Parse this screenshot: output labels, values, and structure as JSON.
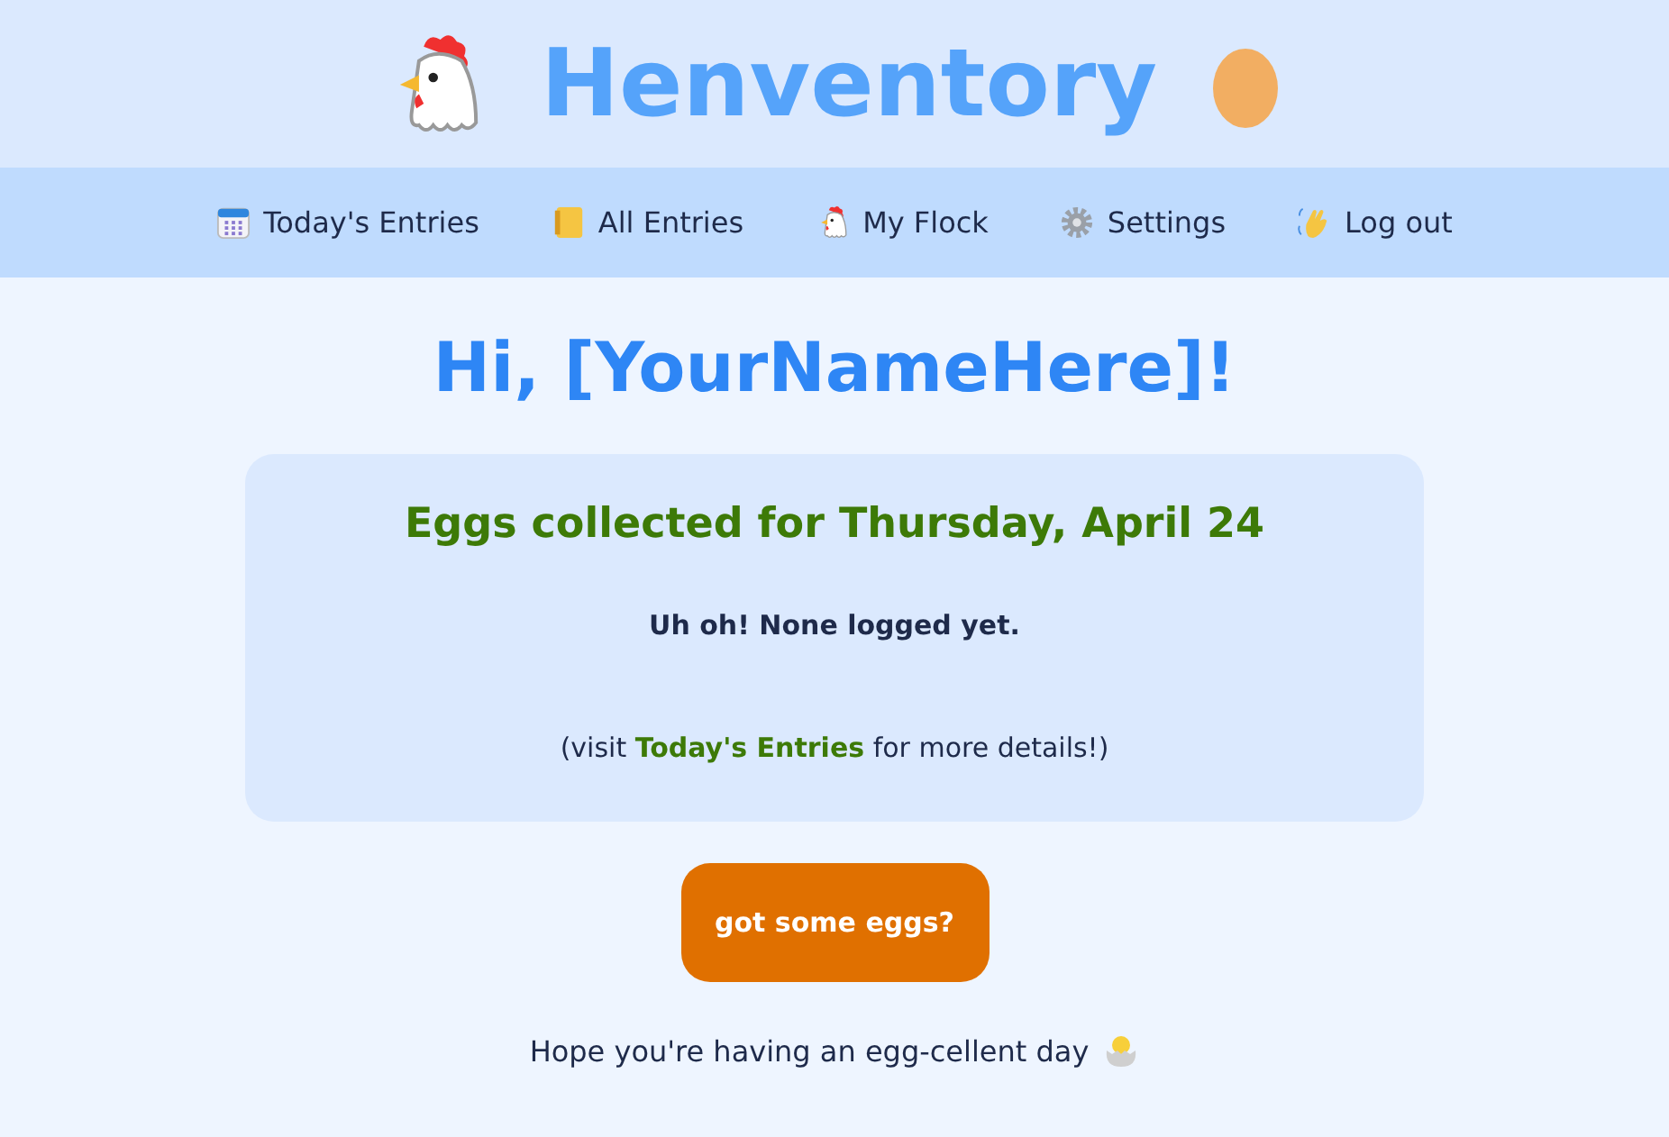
{
  "header": {
    "title": "Henventory"
  },
  "nav": [
    {
      "label": "Today's Entries",
      "kind": "calendar"
    },
    {
      "label": "All Entries",
      "kind": "notebook"
    },
    {
      "label": "My Flock",
      "kind": "chicken"
    },
    {
      "label": "Settings",
      "kind": "gear"
    },
    {
      "label": "Log out",
      "kind": "wave"
    }
  ],
  "greeting": "Hi, [YourNameHere]!",
  "card": {
    "title": "Eggs collected for Thursday, April 24",
    "status": "Uh oh! None logged yet.",
    "note_before": "(visit",
    "note_link": "Today's Entries",
    "note_after": "for more details!)"
  },
  "button": "got some eggs?",
  "footer": "Hope you're having an egg-cellent day"
}
